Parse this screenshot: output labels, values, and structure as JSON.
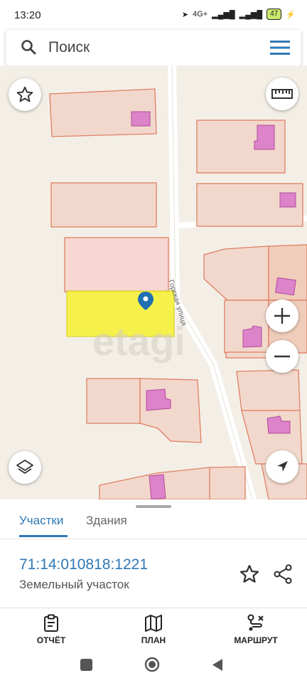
{
  "status": {
    "time": "13:20",
    "battery": "47",
    "network": "4G+"
  },
  "search": {
    "placeholder": "Поиск"
  },
  "map": {
    "street_name": "Горская улица",
    "watermark": "etagi"
  },
  "tabs": [
    {
      "label": "Участки",
      "active": true
    },
    {
      "label": "Здания",
      "active": false
    }
  ],
  "parcel": {
    "cadastral_number": "71:14:010818:1221",
    "type": "Земельный участок"
  },
  "bottom_nav": [
    {
      "label": "ОТЧЁТ",
      "icon": "report-icon"
    },
    {
      "label": "ПЛАН",
      "icon": "map-plan-icon"
    },
    {
      "label": "МАРШРУТ",
      "icon": "route-icon"
    }
  ],
  "colors": {
    "accent": "#2e78b7",
    "selected_parcel": "#f6f23a",
    "building": "#dc83c9",
    "parcel_fill": "#f2d8cc",
    "parcel_border": "#e07f63"
  }
}
